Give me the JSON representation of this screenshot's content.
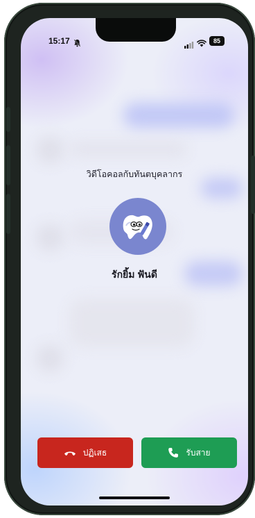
{
  "status_bar": {
    "time": "15:17",
    "battery": "85",
    "icons": [
      "bell-slash-icon",
      "signal-icon",
      "wifi-icon",
      "battery-icon"
    ]
  },
  "call": {
    "title": "วิดีโอคอลกับทันตบุคลากร",
    "caller_name": "รักยิ้ม ฟันดี",
    "avatar_icon": "tooth-mascot-icon"
  },
  "actions": {
    "decline_label": "ปฏิเสธ",
    "decline_icon": "phone-hangup-icon",
    "accept_label": "รับสาย",
    "accept_icon": "phone-icon"
  },
  "colors": {
    "decline": "#c8261e",
    "accept": "#1e9d54",
    "avatar_bg": "#7a86cf"
  }
}
